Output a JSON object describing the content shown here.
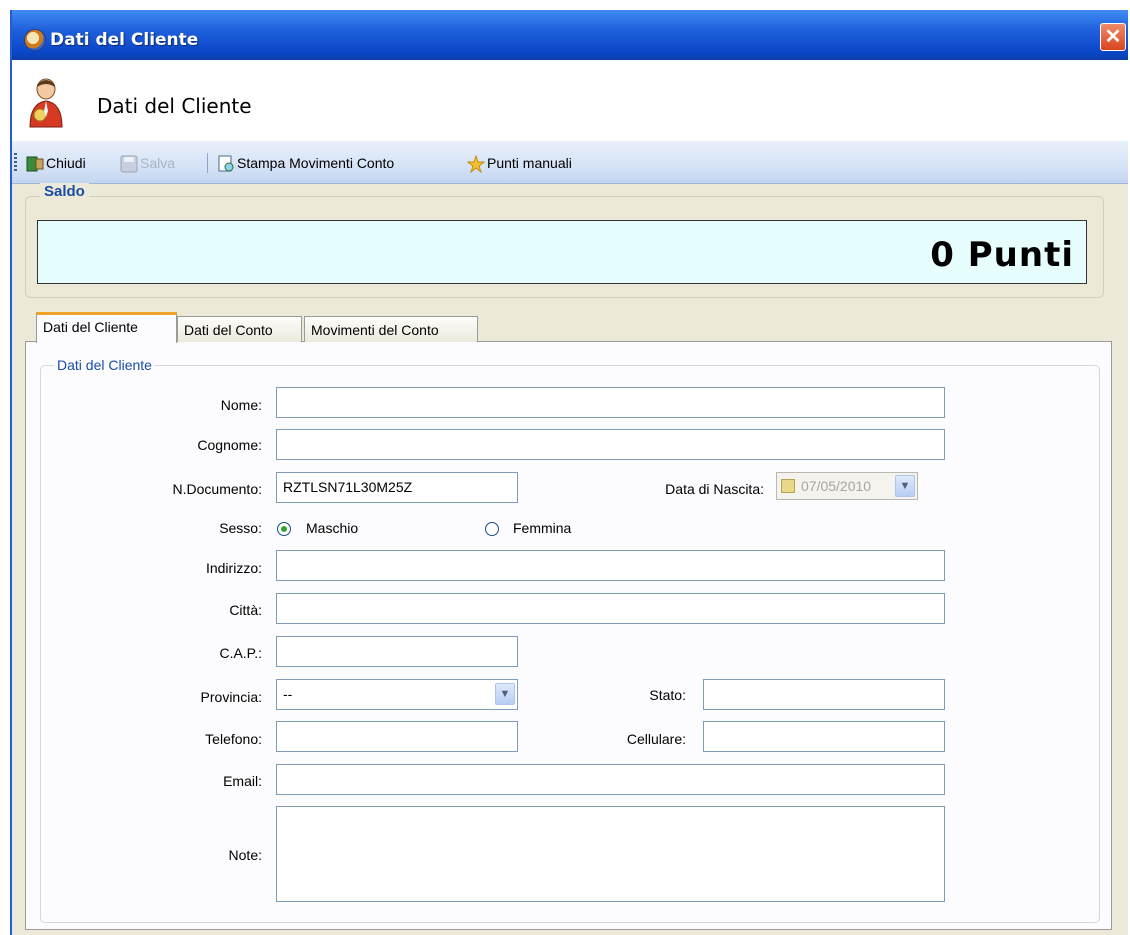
{
  "window": {
    "title": "Dati del Cliente",
    "close_glyph": "✕"
  },
  "header": {
    "title": "Dati del Cliente",
    "icon": "user-icon"
  },
  "toolbar": {
    "close_label": "Chiudi",
    "save_label": "Salva",
    "print_label": "Stampa Movimenti Conto",
    "points_label": "Punti manuali"
  },
  "saldo": {
    "label": "Saldo",
    "value": "0 Punti"
  },
  "tabs": [
    {
      "label": "Dati del Cliente",
      "active": true
    },
    {
      "label": "Dati del Conto",
      "active": false
    },
    {
      "label": "Movimenti del Conto",
      "active": false
    }
  ],
  "form": {
    "group_label": "Dati del Cliente",
    "nome": {
      "label": "Nome:",
      "value": ""
    },
    "cognome": {
      "label": "Cognome:",
      "value": ""
    },
    "documento": {
      "label": "N.Documento:",
      "value": "RZTLSN71L30M25Z"
    },
    "data_nascita": {
      "label": "Data di Nascita:",
      "value": "07/05/2010"
    },
    "sesso": {
      "label": "Sesso:",
      "options": [
        "Maschio",
        "Femmina"
      ],
      "selected": "Maschio"
    },
    "indirizzo": {
      "label": "Indirizzo:",
      "value": ""
    },
    "citta": {
      "label": "Città:",
      "value": ""
    },
    "cap": {
      "label": "C.A.P.:",
      "value": ""
    },
    "provincia": {
      "label": "Provincia:",
      "value": "--"
    },
    "stato": {
      "label": "Stato:",
      "value": ""
    },
    "telefono": {
      "label": "Telefono:",
      "value": ""
    },
    "cellulare": {
      "label": "Cellulare:",
      "value": ""
    },
    "email": {
      "label": "Email:",
      "value": ""
    },
    "note": {
      "label": "Note:",
      "value": ""
    }
  },
  "colors": {
    "titlebar": "#1f5fdb",
    "toolbar": "#d5e3f6",
    "saldo_bg": "#e6fefe",
    "tab_accent": "#f0a22b",
    "group_label": "#1a4ea6"
  }
}
